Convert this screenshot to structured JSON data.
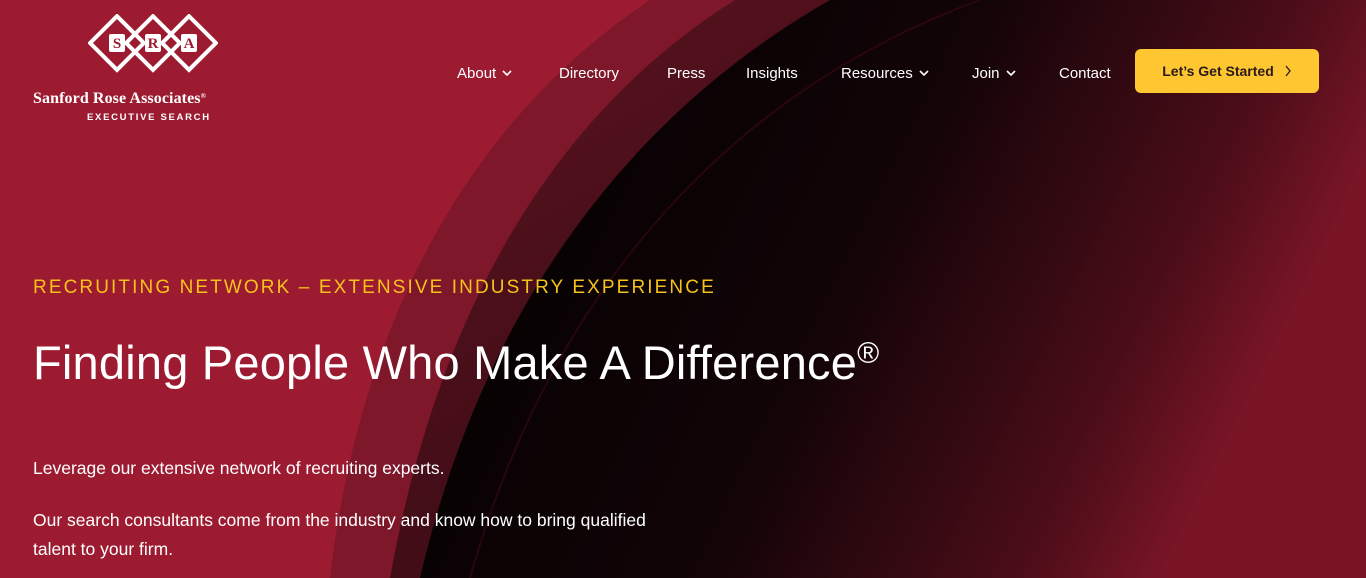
{
  "logo": {
    "letters": [
      "S",
      "R",
      "A"
    ],
    "name": "Sanford Rose Associates",
    "registered": "®",
    "subtitle": "EXECUTIVE SEARCH"
  },
  "nav": {
    "items": [
      {
        "label": "About",
        "has_dropdown": true
      },
      {
        "label": "Directory",
        "has_dropdown": false
      },
      {
        "label": "Press",
        "has_dropdown": false
      },
      {
        "label": "Insights",
        "has_dropdown": false
      },
      {
        "label": "Resources",
        "has_dropdown": true
      },
      {
        "label": "Join",
        "has_dropdown": true
      },
      {
        "label": "Contact",
        "has_dropdown": false
      }
    ],
    "cta_label": "Let’s Get Started"
  },
  "hero": {
    "eyebrow": "RECRUITING NETWORK – EXTENSIVE INDUSTRY EXPERIENCE",
    "headline": "Finding People Who Make A Difference",
    "headline_mark": "®",
    "paragraph_1": "Leverage our extensive network of recruiting experts.",
    "paragraph_2": "Our search consultants come from the industry and know how to bring qualified talent to your firm."
  },
  "colors": {
    "brand_red": "#9c1b31",
    "accent_yellow": "#fec631",
    "eyebrow_yellow": "#f6c21c",
    "dark": "#000000"
  }
}
